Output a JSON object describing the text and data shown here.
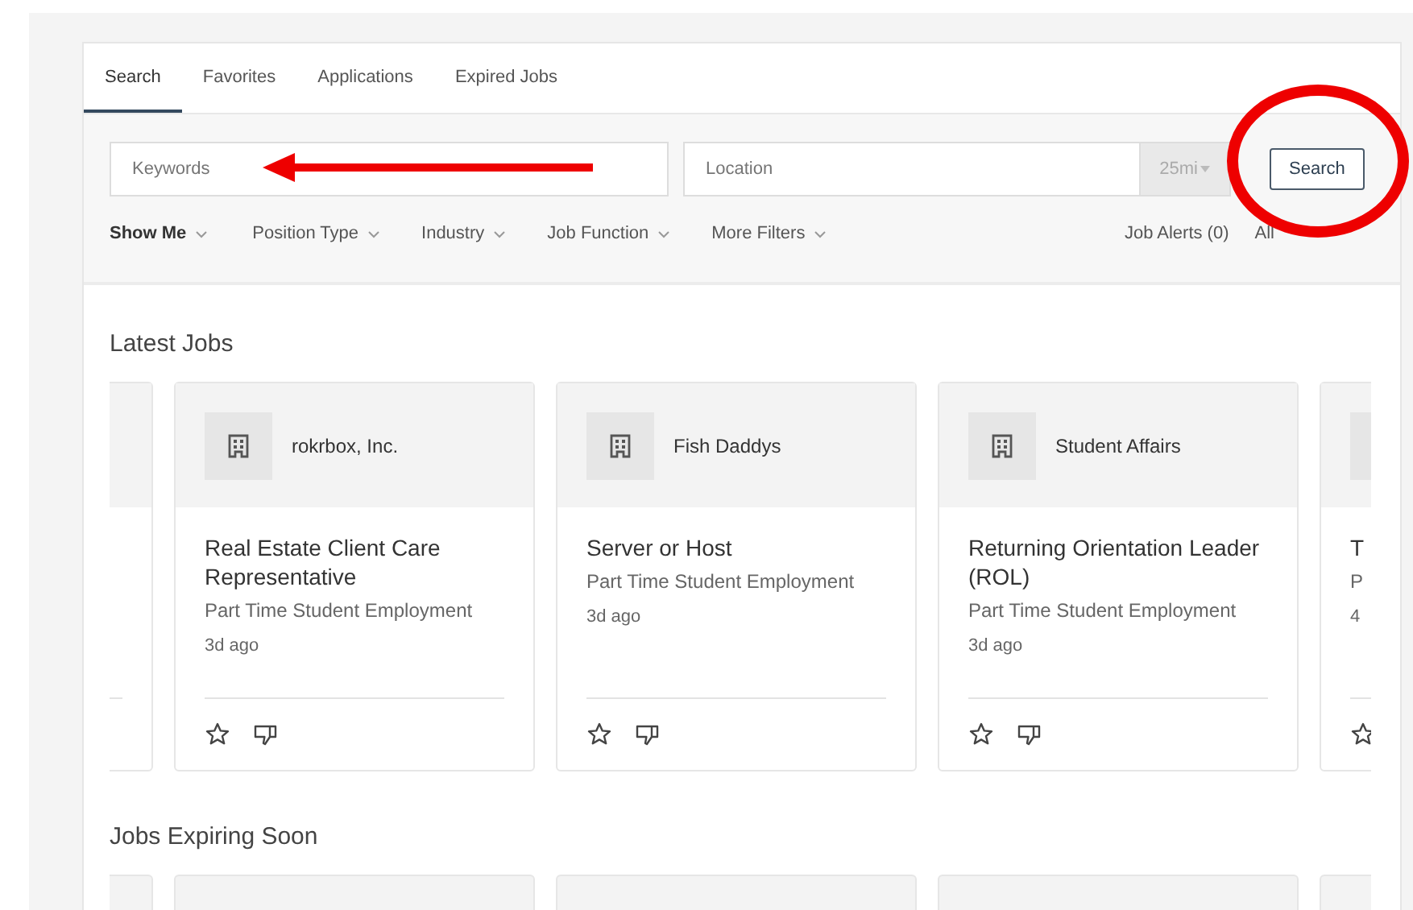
{
  "tabs": [
    {
      "label": "Search",
      "selected": true
    },
    {
      "label": "Favorites",
      "selected": false
    },
    {
      "label": "Applications",
      "selected": false
    },
    {
      "label": "Expired Jobs",
      "selected": false
    }
  ],
  "search": {
    "keywords_placeholder": "Keywords",
    "location_placeholder": "Location",
    "radius": "25mi",
    "button": "Search"
  },
  "filters": [
    {
      "label": "Show Me",
      "bold": true
    },
    {
      "label": "Position Type",
      "bold": false
    },
    {
      "label": "Industry",
      "bold": false
    },
    {
      "label": "Job Function",
      "bold": false
    },
    {
      "label": "More Filters",
      "bold": false
    }
  ],
  "links": [
    "Job Alerts (0)",
    "All"
  ],
  "latest": {
    "title": "Latest Jobs",
    "jobs": [
      {
        "employer": "rokrbox, Inc.",
        "title": "Real Estate Client Care Representative",
        "type": "Part Time Student Employment",
        "age": "3d ago"
      },
      {
        "employer": "Fish Daddys",
        "title": "Server or Host",
        "type": "Part Time Student Employment",
        "age": "3d ago"
      },
      {
        "employer": "Student Affairs",
        "title": "Returning Orientation Leader (ROL)",
        "type": "Part Time Student Employment",
        "age": "3d ago"
      },
      {
        "title": "T",
        "type": "P",
        "age": "4"
      }
    ]
  },
  "expiring": {
    "title": "Jobs Expiring Soon"
  }
}
